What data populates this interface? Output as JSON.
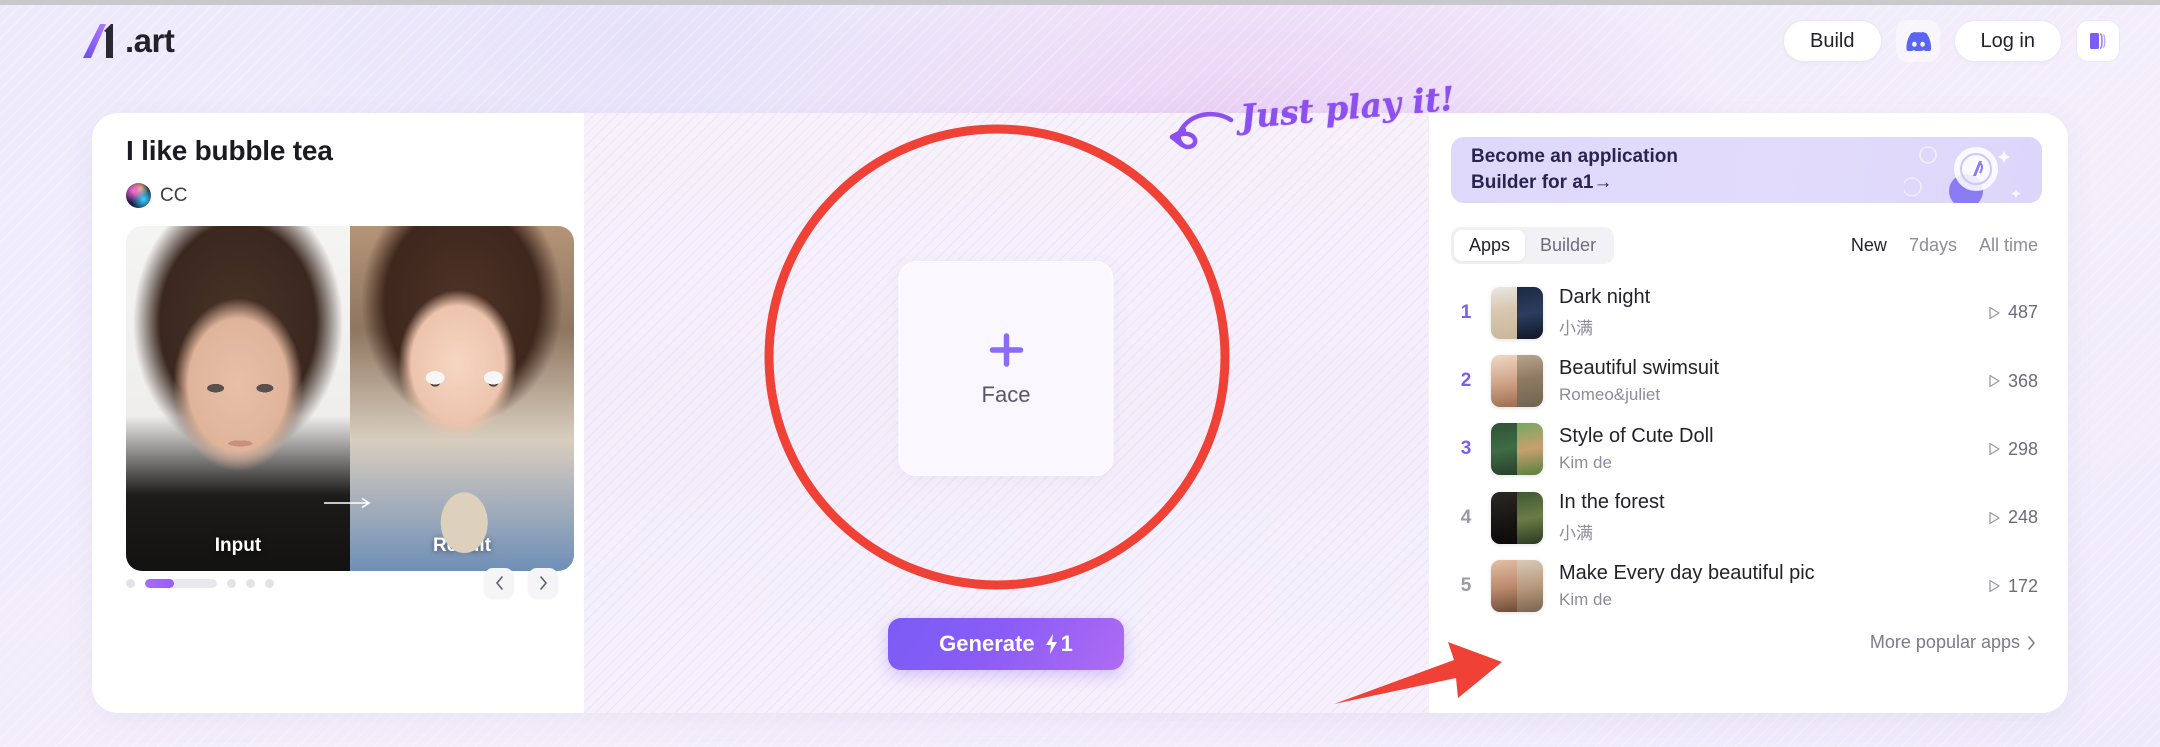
{
  "header": {
    "logo_text": ".art",
    "logo_icon": "a1-logo-icon",
    "build_label": "Build",
    "discord_icon": "discord-icon",
    "login_label": "Log in",
    "book_icon": "book-stack-icon"
  },
  "left": {
    "app_title": "I like bubble tea",
    "author": "CC",
    "avatar_icon": "user-avatar",
    "input_label": "Input",
    "result_label": "Result",
    "arrow_icon": "arrow-right-icon",
    "prev_icon": "chevron-left-icon",
    "next_icon": "chevron-right-icon",
    "dots_total": 5,
    "active_dot_index": 1
  },
  "center": {
    "upload_plus_icon": "plus-icon",
    "upload_label": "Face",
    "generate_label": "Generate",
    "generate_credit_icon": "lightning-bolt-icon",
    "generate_credit": "1"
  },
  "right": {
    "banner_text": "Become an application\nBuilder for a1→",
    "banner_icon": "coin-badge-icon",
    "tabs": [
      {
        "label": "Apps",
        "active": true
      },
      {
        "label": "Builder",
        "active": false
      }
    ],
    "filters": [
      {
        "label": "New",
        "active": true
      },
      {
        "label": "7days",
        "active": false
      },
      {
        "label": "All time",
        "active": false
      }
    ],
    "view_icon": "play-triangle-icon",
    "ranking": [
      {
        "rank": "1",
        "title": "Dark night",
        "author": "小满",
        "views": "487",
        "hot": true
      },
      {
        "rank": "2",
        "title": "Beautiful swimsuit",
        "author": "Romeo&juliet",
        "views": "368",
        "hot": true
      },
      {
        "rank": "3",
        "title": "Style of Cute Doll",
        "author": "Kim de",
        "views": "298",
        "hot": true
      },
      {
        "rank": "4",
        "title": "In the forest",
        "author": "小满",
        "views": "248",
        "hot": false
      },
      {
        "rank": "5",
        "title": "Make Every day beautiful pic",
        "author": "Kim de",
        "views": "172",
        "hot": false
      }
    ],
    "more_label": "More popular apps",
    "more_icon": "chevron-right-icon"
  },
  "annotations": {
    "handwriting": "Just play it!",
    "circle_icon": "red-circle-highlight",
    "curve_arrow_icon": "purple-curved-arrow-icon",
    "red_arrow_icon": "red-arrow-icon"
  },
  "colors": {
    "accent_purple": "#7c5cf7",
    "annotation_red": "#ef4136",
    "annotation_purple": "#8c4ff0"
  }
}
